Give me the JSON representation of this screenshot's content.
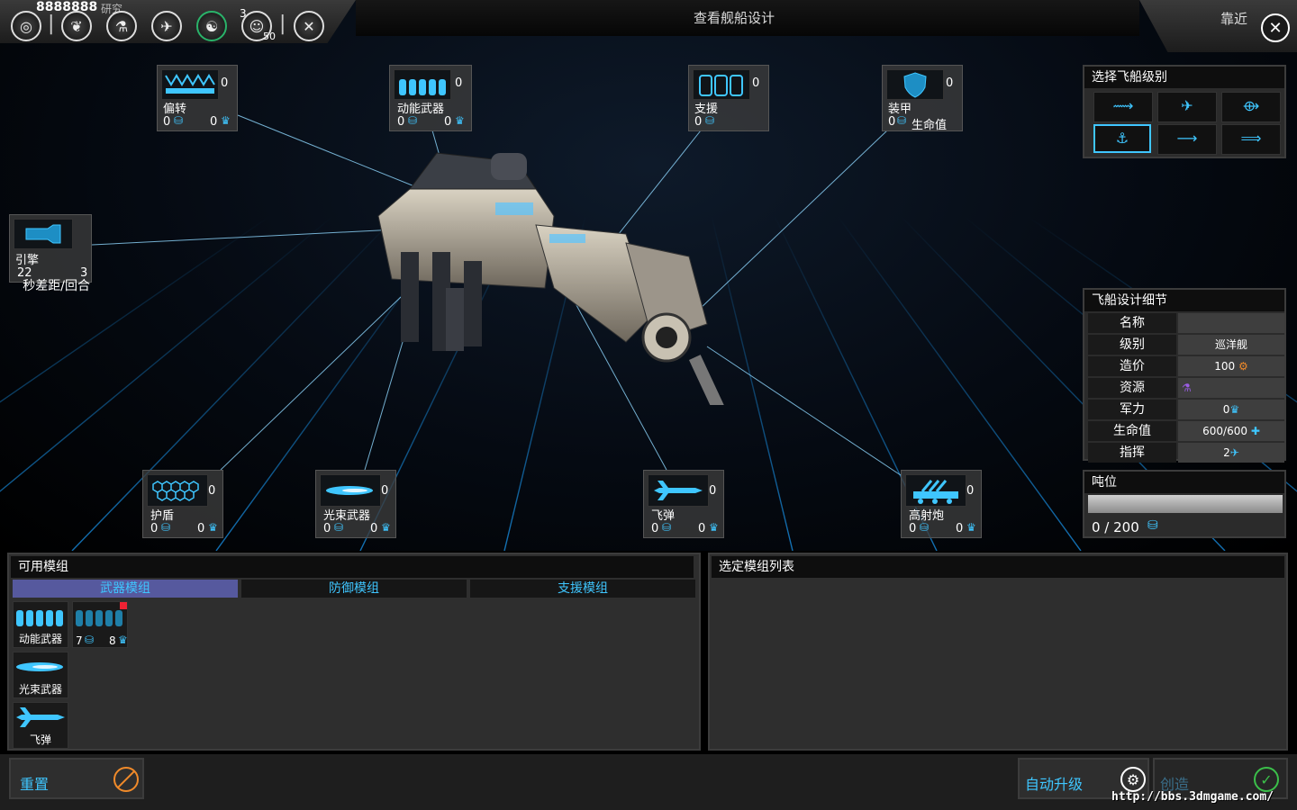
{
  "topbar": {
    "counter": "8888888",
    "research_label": "研究",
    "icon_badge_a": "3",
    "icon_badge_b": "50",
    "title": "查看舰船设计",
    "zoom_label": "靠近"
  },
  "slots": {
    "deflect": {
      "name": "偏转",
      "count": "0",
      "a": "0",
      "b": "0"
    },
    "kinetic": {
      "name": "动能武器",
      "count": "0",
      "a": "0",
      "b": "0"
    },
    "support": {
      "name": "支援",
      "count": "0",
      "a": "0"
    },
    "armor": {
      "name": "装甲",
      "count": "0",
      "a": "0",
      "unit": "生命值"
    },
    "engine": {
      "name": "引擎",
      "a": "22",
      "b": "3",
      "unit": "秒差距/回合"
    },
    "shield": {
      "name": "护盾",
      "count": "0",
      "a": "0",
      "b": "0"
    },
    "beam": {
      "name": "光束武器",
      "count": "0",
      "a": "0",
      "b": "0"
    },
    "missile": {
      "name": "飞弹",
      "count": "0",
      "a": "0",
      "b": "0"
    },
    "flak": {
      "name": "高射炮",
      "count": "0",
      "a": "0",
      "b": "0"
    }
  },
  "ship_class_panel": {
    "title": "选择飞船级别"
  },
  "details_panel": {
    "title": "飞船设计细节",
    "rows": [
      {
        "key": "名称",
        "value": ""
      },
      {
        "key": "级别",
        "value": "巡洋舰"
      },
      {
        "key": "造价",
        "value": "100"
      },
      {
        "key": "资源",
        "value": ""
      },
      {
        "key": "军力",
        "value": "0"
      },
      {
        "key": "生命值",
        "value": "600/600"
      },
      {
        "key": "指挥",
        "value": "2"
      }
    ]
  },
  "tonnage": {
    "title": "吨位",
    "value": "0 / 200",
    "fill": 0
  },
  "modules_panel": {
    "title": "可用模组",
    "tabs": [
      "武器模组",
      "防御模组",
      "支援模组"
    ],
    "items": [
      {
        "name": "动能武器"
      },
      {
        "name": "",
        "a": "7",
        "b": "8"
      },
      {
        "name": "光束武器"
      },
      {
        "name": "飞弹"
      }
    ]
  },
  "selected_panel": {
    "title": "选定模组列表"
  },
  "bottom": {
    "reset": "重置",
    "auto_upgrade": "自动升级",
    "create": "创造"
  },
  "watermark": "http://bbs.3dmgame.com/",
  "colors": {
    "accent": "#3fc6ff",
    "tab_active": "#56599e",
    "reset_icon": "#f08a2a",
    "create_icon": "#3bbf4a"
  }
}
